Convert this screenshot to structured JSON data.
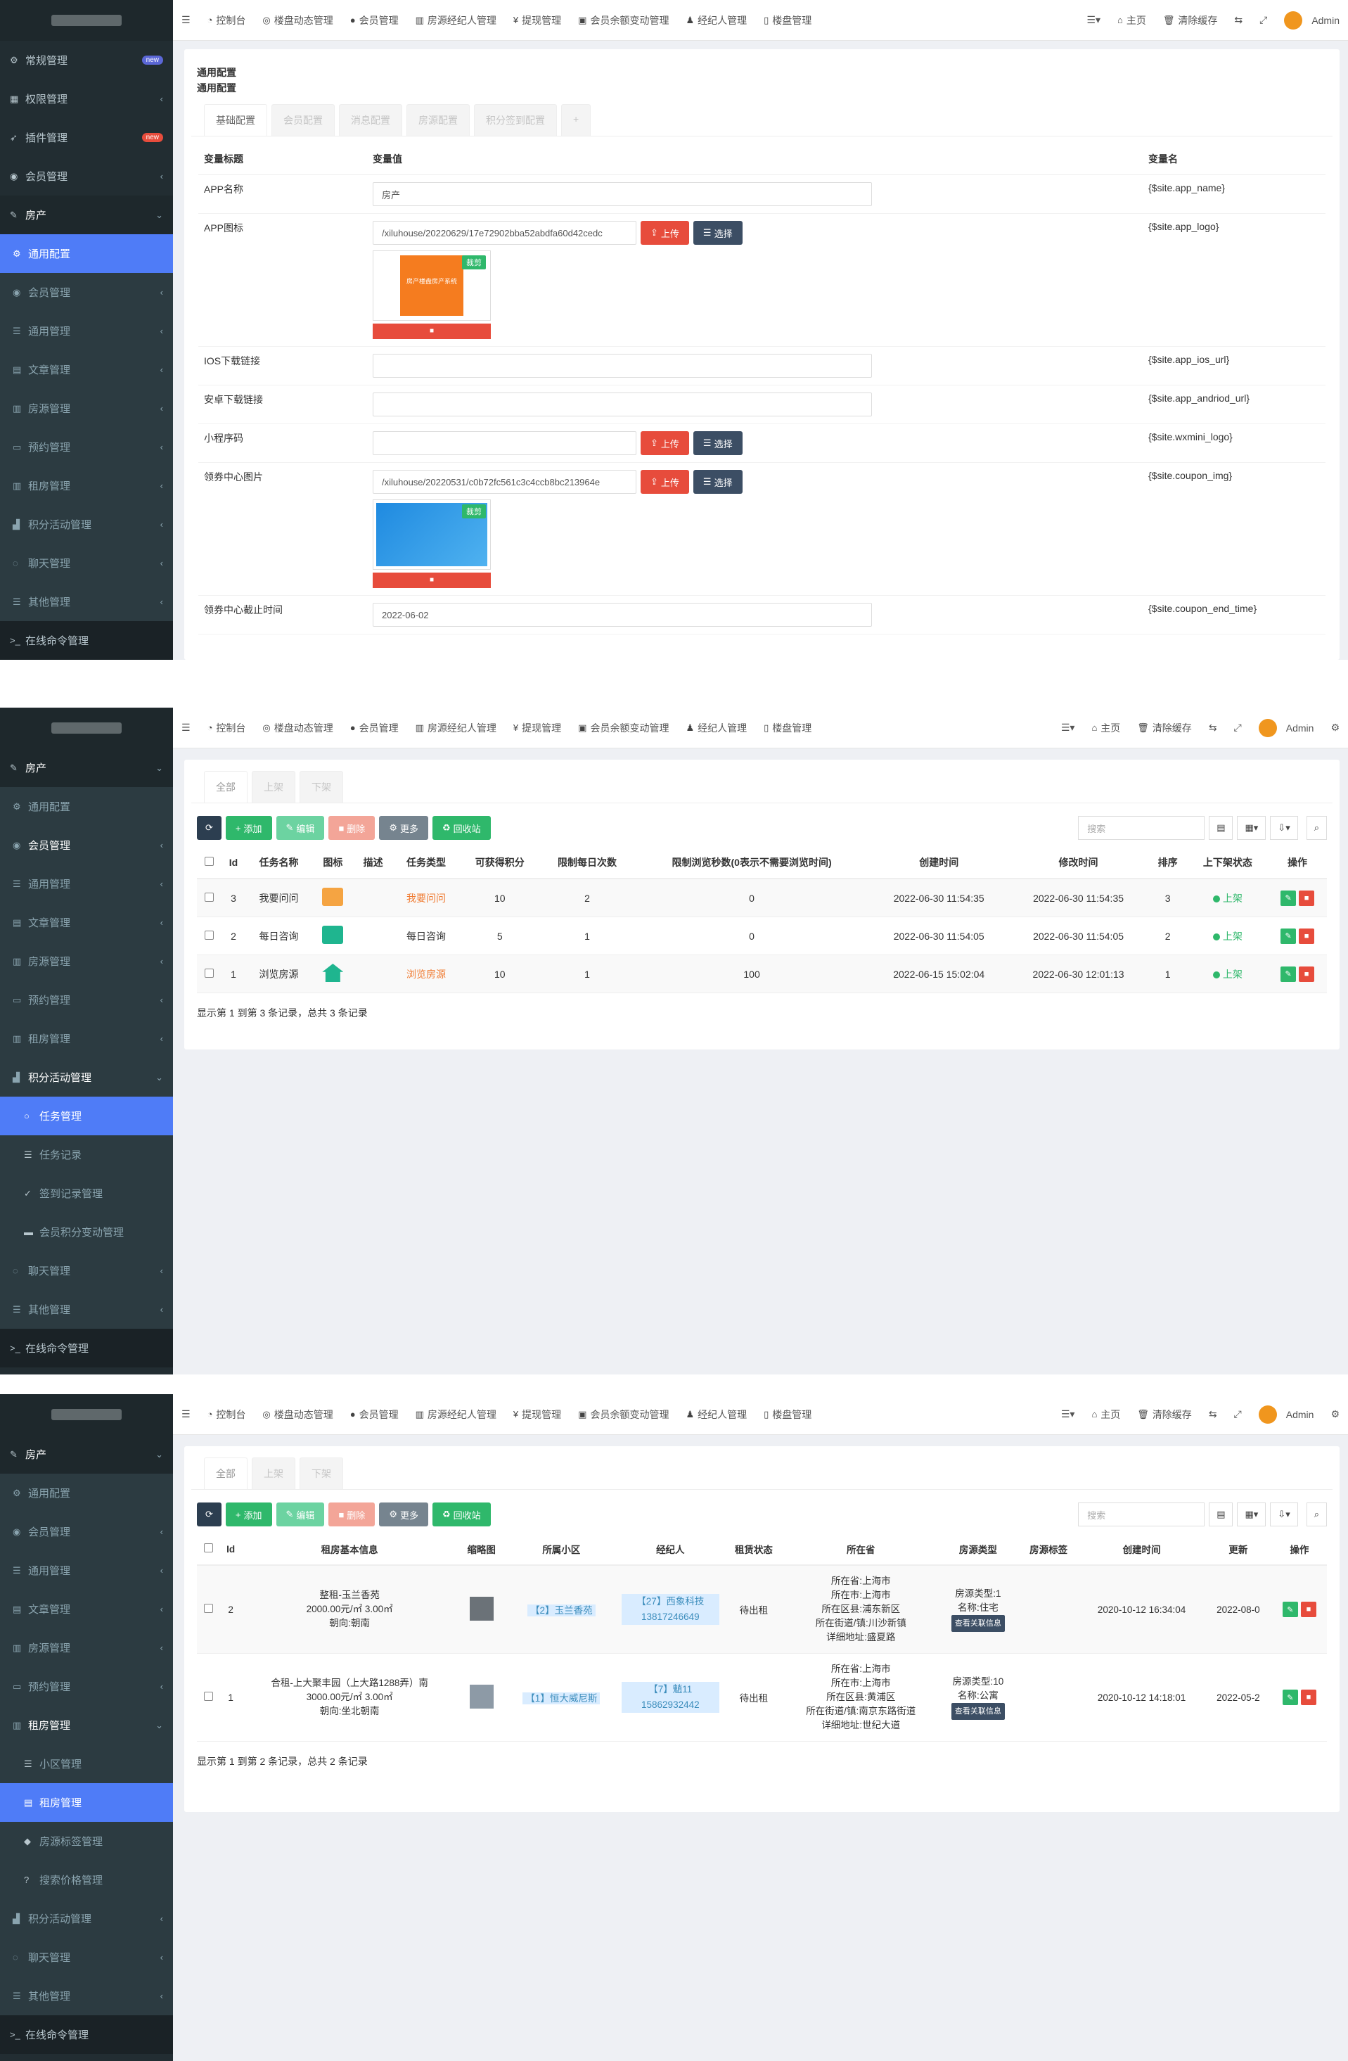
{
  "topbar": {
    "items": [
      "控制台",
      "楼盘动态管理",
      "会员管理",
      "房源经纪人管理",
      "提现管理",
      "会员余额变动管理",
      "经纪人管理",
      "楼盘管理"
    ],
    "home": "主页",
    "clear_cache": "清除缓存",
    "user": "Admin"
  },
  "s1": {
    "sidebar": [
      {
        "label": "常规管理",
        "badge": "new"
      },
      {
        "label": "权限管理"
      },
      {
        "label": "插件管理",
        "badge": "new"
      },
      {
        "label": "会员管理"
      },
      {
        "label": "房产"
      },
      {
        "label": "通用配置"
      },
      {
        "label": "会员管理"
      },
      {
        "label": "通用管理"
      },
      {
        "label": "文章管理"
      },
      {
        "label": "房源管理"
      },
      {
        "label": "预约管理"
      },
      {
        "label": "租房管理"
      },
      {
        "label": "积分活动管理"
      },
      {
        "label": "聊天管理"
      },
      {
        "label": "其他管理"
      },
      {
        "label": "在线命令管理"
      }
    ],
    "title": "通用配置",
    "subtitle": "通用配置",
    "tabs": [
      "基础配置",
      "会员配置",
      "消息配置",
      "房源配置",
      "积分签到配置",
      "+"
    ],
    "headers": [
      "变量标题",
      "变量值",
      "变量名"
    ],
    "upload": "上传",
    "choose": "选择",
    "crop": "裁剪",
    "app_logo_caption": "房产楼盘房产系统",
    "rows": {
      "app_name": {
        "label": "APP名称",
        "value": "房产",
        "var": "{$site.app_name}"
      },
      "app_logo": {
        "label": "APP图标",
        "value": "/xiluhouse/20220629/17e72902bba52abdfa60d42cedc",
        "var": "{$site.app_logo}"
      },
      "ios": {
        "label": "IOS下载链接",
        "value": "",
        "var": "{$site.app_ios_url}"
      },
      "android": {
        "label": "安卓下载链接",
        "value": "",
        "var": "{$site.app_andriod_url}"
      },
      "wxmini": {
        "label": "小程序码",
        "value": "",
        "var": "{$site.wxmini_logo}"
      },
      "coupon_img": {
        "label": "领券中心图片",
        "value": "/xiluhouse/20220531/c0b72fc561c3c4ccb8bc213964e",
        "var": "{$site.coupon_img}"
      },
      "coupon_end": {
        "label": "领券中心截止时间",
        "value": "2022-06-02",
        "var": "{$site.coupon_end_time}"
      }
    }
  },
  "s2": {
    "sidebar": [
      {
        "label": "房产"
      },
      {
        "label": "通用配置"
      },
      {
        "label": "会员管理"
      },
      {
        "label": "通用管理"
      },
      {
        "label": "文章管理"
      },
      {
        "label": "房源管理"
      },
      {
        "label": "预约管理"
      },
      {
        "label": "租房管理"
      },
      {
        "label": "积分活动管理"
      },
      {
        "label": "任务管理"
      },
      {
        "label": "任务记录"
      },
      {
        "label": "签到记录管理"
      },
      {
        "label": "会员积分变动管理"
      },
      {
        "label": "聊天管理"
      },
      {
        "label": "其他管理"
      },
      {
        "label": "在线命令管理"
      }
    ],
    "tabs": [
      "全部",
      "上架",
      "下架"
    ],
    "buttons": [
      "添加",
      "编辑",
      "删除",
      "更多",
      "回收站"
    ],
    "search": "搜索",
    "columns": [
      "Id",
      "任务名称",
      "图标",
      "描述",
      "任务类型",
      "可获得积分",
      "限制每日次数",
      "限制浏览秒数(0表示不需要浏览时间)",
      "创建时间",
      "修改时间",
      "排序",
      "上下架状态",
      "操作"
    ],
    "rows": [
      {
        "id": "3",
        "name": "我要问问",
        "type": "我要问问",
        "points": "10",
        "daily": "2",
        "secs": "0",
        "created": "2022-06-30 11:54:35",
        "updated": "2022-06-30 11:54:35",
        "sort": "3",
        "status": "上架",
        "icon_color": "#f5a442",
        "type_orange": true
      },
      {
        "id": "2",
        "name": "每日咨询",
        "type": "每日咨询",
        "points": "5",
        "daily": "1",
        "secs": "0",
        "created": "2022-06-30 11:54:05",
        "updated": "2022-06-30 11:54:05",
        "sort": "2",
        "status": "上架",
        "icon_color": "#1fb58f",
        "type_orange": false
      },
      {
        "id": "1",
        "name": "浏览房源",
        "type": "浏览房源",
        "points": "10",
        "daily": "1",
        "secs": "100",
        "created": "2022-06-15 15:02:04",
        "updated": "2022-06-30 12:01:13",
        "sort": "1",
        "status": "上架",
        "icon_color": "#1fb58f",
        "type_orange": true
      }
    ],
    "footer": "显示第 1 到第 3 条记录，总共 3 条记录"
  },
  "s3": {
    "sidebar": [
      {
        "label": "房产"
      },
      {
        "label": "通用配置"
      },
      {
        "label": "会员管理"
      },
      {
        "label": "通用管理"
      },
      {
        "label": "文章管理"
      },
      {
        "label": "房源管理"
      },
      {
        "label": "预约管理"
      },
      {
        "label": "租房管理"
      },
      {
        "label": "小区管理"
      },
      {
        "label": "租房管理"
      },
      {
        "label": "房源标签管理"
      },
      {
        "label": "搜索价格管理"
      },
      {
        "label": "积分活动管理"
      },
      {
        "label": "聊天管理"
      },
      {
        "label": "其他管理"
      },
      {
        "label": "在线命令管理"
      }
    ],
    "tabs": [
      "全部",
      "上架",
      "下架"
    ],
    "buttons": [
      "添加",
      "编辑",
      "删除",
      "更多",
      "回收站"
    ],
    "search": "搜索",
    "columns": [
      "Id",
      "租房基本信息",
      "缩略图",
      "所属小区",
      "经纪人",
      "租赁状态",
      "所在省",
      "房源类型",
      "房源标签",
      "创建时间",
      "更新",
      "操作"
    ],
    "related_btn": "查看关联信息",
    "rows": [
      {
        "id": "2",
        "info": [
          "整租-玉兰香苑",
          "2000.00元/㎡ 3.00㎡",
          "朝向:朝南"
        ],
        "community": "【2】玉兰香苑",
        "agent": [
          "【27】西象科技",
          "13817246649"
        ],
        "state": "待出租",
        "addr": [
          "所在省:上海市",
          "所在市:上海市",
          "所在区县:浦东新区",
          "所在街道/镇:川沙新镇",
          "详细地址:盛夏路"
        ],
        "htype": [
          "房源类型:1",
          "名称:住宅"
        ],
        "created": "2020-10-12 16:34:04",
        "updated": "2022-08-0"
      },
      {
        "id": "1",
        "info": [
          "合租-上大聚丰园（上大路1288弄）南",
          "3000.00元/㎡ 3.00㎡",
          "朝向:坐北朝南"
        ],
        "community": "【1】恒大威尼斯",
        "agent": [
          "【7】魈11",
          "15862932442"
        ],
        "state": "待出租",
        "addr": [
          "所在省:上海市",
          "所在市:上海市",
          "所在区县:黄浦区",
          "所在街道/镇:南京东路街道",
          "详细地址:世纪大道"
        ],
        "htype": [
          "房源类型:10",
          "名称:公寓"
        ],
        "created": "2020-10-12 14:18:01",
        "updated": "2022-05-2"
      }
    ],
    "footer": "显示第 1 到第 2 条记录，总共 2 条记录"
  }
}
